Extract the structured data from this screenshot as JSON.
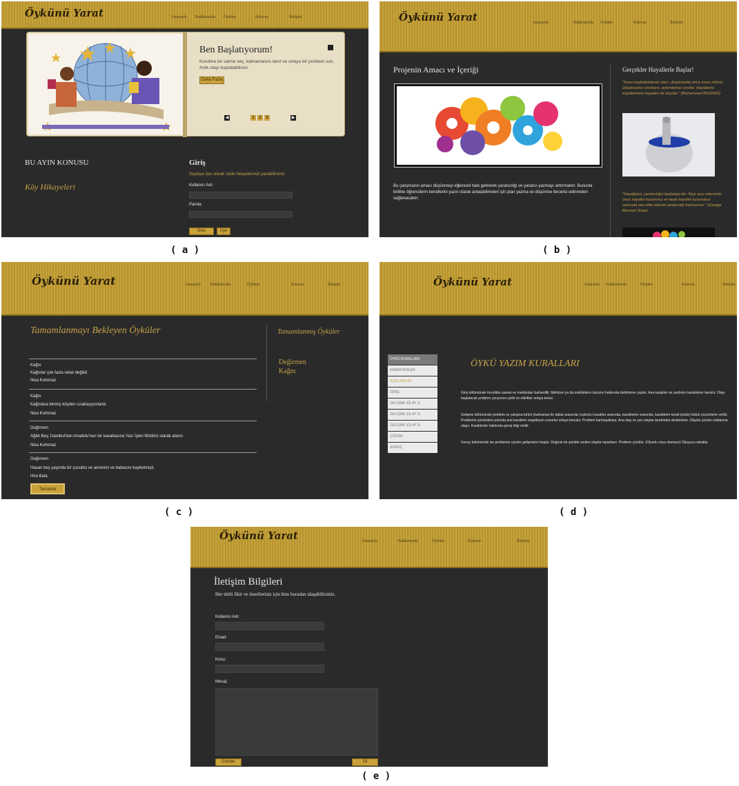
{
  "site": {
    "logo": "Öykünü Yarat"
  },
  "nav": [
    "Anasayfa",
    "Hakkımızda",
    "Öyküm",
    "Kılavuz",
    "İletişim"
  ],
  "captions": [
    "( a )",
    "( b )",
    "( c )",
    "( d )",
    "( e )"
  ],
  "a": {
    "slider_title": "Ben Başlatıyorum!",
    "slider_text": "Kurulme bir salme seç, kahramanını tanıt ve ortaya bir problem sun. Artık olayı başlatabilirsin.",
    "more_button": "Daha Fazla",
    "pages": [
      "1",
      "2",
      "3"
    ],
    "month_topic_label": "BU AYIN KONUSU",
    "month_topic": "Köy Hikayeleri",
    "login_title": "Giriş",
    "login_note": "Sayfaya üye olarak sizde hikayelerinizi yazabilirsiniz.",
    "username_label": "Kullanıcı Adı:",
    "password_label": "Parola:",
    "login_button": "Giriş",
    "signup_button": "Üye Ol"
  },
  "b": {
    "title": "Projenin Amacı ve İçeriği",
    "body": "Bu çalışmanın amacı düşünmeyi eğlenceli hale getirerek yaratıcılığı ve yaratıcı yazmayı arttırmaktır. Bununla birlikte öğrencilerin kendilerini yazılı olarak anlatabilmeleri için plan yazma ve düşünme becerisi edinmeleri sağlanacaktır.",
    "side_title": "Gerçekler Hayallerle Başlar!",
    "quote1": "\"İnsan keşfedebilecek olanı, düşünmekle önce insan zihindi. Düşüncenizi sınırlayın, eylemleriniz sınırlar. Hayallerini küçültenlerin hayalleri de küçülür.\" (Muhammed BOZDAĞ)",
    "quote2": "\"Hayalgücü, yaratıcılığın başlangıcıdır. Neyi arzu ederseniz onun hayalini kurarsınız ve neyin hayalini kurarsanız sonunda onu elde edecek yaratıcılığı bulursunuz.\" (George Bernard Shaw)"
  },
  "c": {
    "title": "Tamamlanmayı Bekleyen Öyküler",
    "side_title": "Tamamlanmış Öyküler",
    "completed": [
      "Değirmen",
      "Kağnı"
    ],
    "stories": [
      {
        "title": "Kağnı",
        "text": "Kağnılar çok fazla rahat değildi",
        "author": "Nisa Korkmaz"
      },
      {
        "title": "Kağnı",
        "text": "Kağnılara binmiş köyden uzaklaşıyorlardı.",
        "author": "Nisa Korkmaz"
      },
      {
        "title": "Değirmen",
        "text": "Ağâh Bey, İstanbul'dan Anadolu'nun bir kasabasına Yazı İşleri Müdürü olarak atanır.",
        "author": "Nisa Korkmaz"
      },
      {
        "title": "Değirmen",
        "text": "Hasan beş yaşında bir çocuktu ve annesini ve babasını kaybetmişti.",
        "author": "Hira Bala"
      }
    ],
    "complete_button": "Tamamla"
  },
  "d": {
    "menu": [
      "ÖYKÜ KURALLARI",
      "KARAKTERLER",
      "AÇIKLAMLAR",
      "GİRİŞ",
      "GELİŞME (OLAY 1)",
      "GELİŞME (OLAY 2)",
      "GELİŞME (OLAY 3)",
      "ÇÖZÜM",
      "SONUÇ"
    ],
    "title": "ÖYKÜ YAZIM KURALLARI",
    "p1": "Giriş bölümünde öncelikle zaman ve mekândan bahsedilir. Mekânın ya da mekânların durumu hakkında betimlerne yapılır. Ana karakter ve yardımcı karakterler tanıtılır. Olayı başlatacak problem çerçevesi çizilir ve ettirikler ortaya konur.",
    "p2": "Gelişme bölümünde problem ve çatışma türleri (kahraman ile tabiat arasında, kışkırtıcı karakter arasında, karakterler arasında, karakterin kendi içinde) bütün çözümlerle verilir. Problemin çözümlesi yolunda ana karakteri engelleyen unsurlar ortaya konulur. Problem karmaşıklaşır. Ana olay ve yan olaylar tarafından desteklenir. Olaylar çözüm noktasına ulaşır. Karakterler hakkında geniş bilgi verilir.",
    "p3": "Sonuç bölümünde ise problemin çözüm gelişmeleri başlar. Dağınık bir şekilde verilen olaylar toparlanır. Problem çözülür. (Olumlu veya olumsuz) Okuyucu rahatlar."
  },
  "e": {
    "title": "İletişim Bilgileri",
    "subtitle": "Her türlü fikir ve önerileriniz için bize buradan ulaşabilirsiniz.",
    "username_label": "Kullanıcı Adı:",
    "email_label": "Email:",
    "subject_label": "Konu:",
    "message_label": "Mesaj:",
    "send_button": "Gönder",
    "cancel_button": "Sil"
  }
}
